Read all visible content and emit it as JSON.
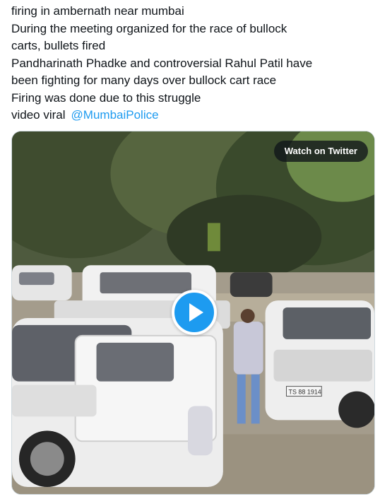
{
  "tweet": {
    "lines": [
      "firing in ambernath near mumbai",
      "During the meeting organized for the race of bullock",
      "carts, bullets fired",
      "Pandharinath Phadke and controversial Rahul Patil have",
      "been fighting for many days over bullock cart race",
      "Firing was done due to this struggle"
    ],
    "last_line_text": "video viral",
    "mention": "@MumbaiPolice"
  },
  "media": {
    "watch_label": "Watch on Twitter",
    "play_icon": "play-icon",
    "plate_text": "TS 88 1914"
  },
  "colors": {
    "text": "#0f1419",
    "link": "#1d9bf0",
    "play_button": "#1d9bf0"
  }
}
